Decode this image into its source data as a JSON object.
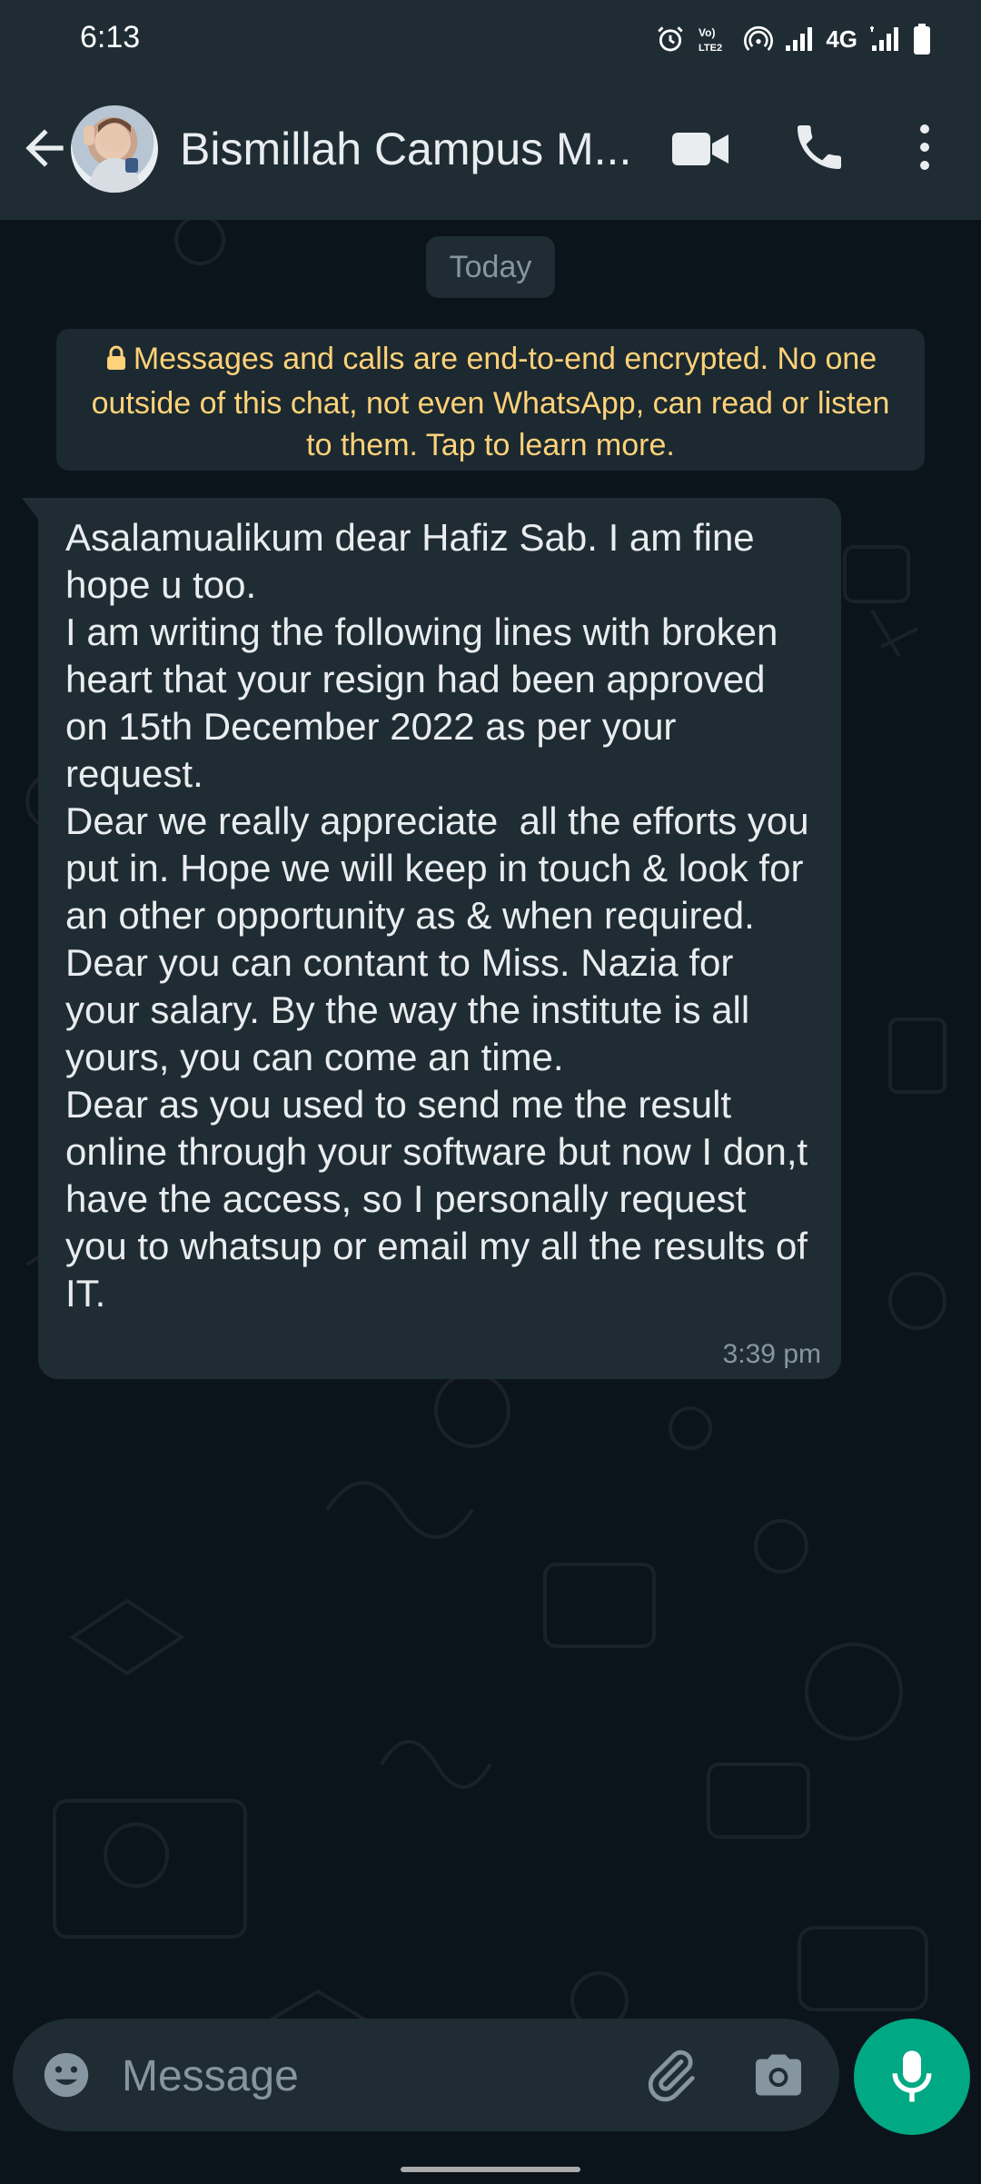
{
  "status_bar": {
    "time": "6:13",
    "network_label": "4G",
    "icons": [
      "alarm-icon",
      "volte-icon",
      "hotspot-icon",
      "signal-icon",
      "signal-icon",
      "battery-icon"
    ]
  },
  "header": {
    "contact_name": "Bismillah Campus M...",
    "icons": [
      "back-arrow-icon",
      "video-call-icon",
      "phone-icon",
      "more-vert-icon"
    ]
  },
  "chat": {
    "date_chip": "Today",
    "encryption_notice": "Messages and calls are end-to-end encrypted. No one outside of this chat, not even WhatsApp, can read or listen to them. Tap to learn more.",
    "messages": [
      {
        "direction": "incoming",
        "text": "Asalamualikum dear Hafiz Sab. I am fine hope u too.\nI am writing the following lines with broken heart that your resign had been approved on 15th December 2022 as per your request.\nDear we really appreciate  all the efforts you put in. Hope we will keep in touch & look for an other opportunity as & when required.\nDear you can contant to Miss. Nazia for your salary. By the way the institute is all yours, you can come an time.\nDear as you used to send me the result online through your software but now I don,t have the access, so I personally request you to whatsup or email my all the results of IT.",
        "time": "3:39 pm"
      }
    ]
  },
  "composer": {
    "placeholder": "Message",
    "icons": [
      "emoji-icon",
      "attach-icon",
      "camera-icon",
      "mic-icon"
    ]
  },
  "colors": {
    "app_bar": "#1f2c34",
    "chat_background": "#0b141a",
    "bubble_incoming": "#202c33",
    "notice_text": "#ffd279",
    "accent": "#00a884"
  }
}
